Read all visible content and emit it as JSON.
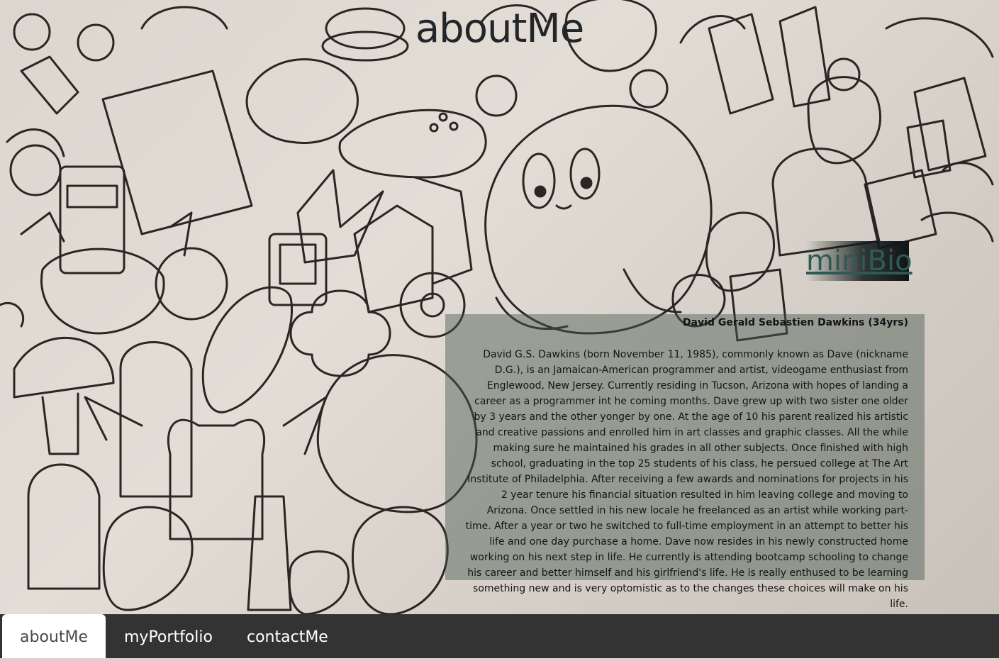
{
  "page": {
    "title": "aboutMe"
  },
  "minibio": {
    "heading": "miniBio",
    "name": "David Gerald Sebastien Dawkins (34yrs)",
    "text": "David G.S. Dawkins (born November 11, 1985), commonly known as Dave (nickname D.G.), is an Jamaican-American programmer and artist, videogame enthusiast from Englewood, New Jersey. Currently residing in Tucson, Arizona with hopes of landing a career as a programmer int he coming months. Dave grew up with two sister one older by 3 years and the other yonger by one. At the age of 10 his parent realized his artistic and creative passions and enrolled him in art classes and graphic classes. All the while making sure he maintained his grades in all other subjects. Once finished with high school, graduating in the top 25 students of his class, he persued college at The Art Institute of Philadelphia. After receiving a few awards and nominations for projects in his 2 year tenure his financial situation resulted in him leaving college and moving to Arizona. Once settled in his new locale he freelanced as an artist while working part-time. After a year or two he switched to full-time employment in an attempt to better his life and one day purchase a home. Dave now resides in his newly constructed home working on his next step in life. He currently is attending bootcamp schooling to change his career and better himself and his girlfriend's life. He is really enthused to be learning something new and is very optomistic as to the changes these choices will make on his life."
  },
  "nav": {
    "tabs": [
      {
        "label": "aboutMe",
        "active": true
      },
      {
        "label": "myPortfolio",
        "active": false
      },
      {
        "label": "contactMe",
        "active": false
      }
    ]
  },
  "colors": {
    "navbar": "#333333",
    "panel": "#46584f",
    "heading": "#2e5a56"
  }
}
